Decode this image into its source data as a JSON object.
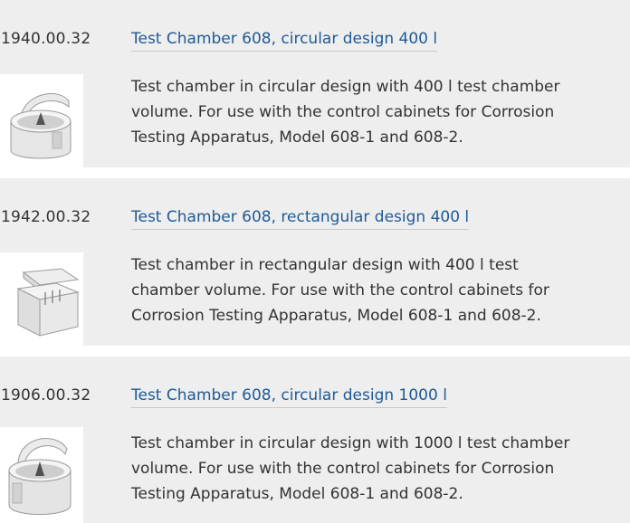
{
  "products": [
    {
      "code": "1940.00.32",
      "title": "Test Chamber 608, circular design 400 l",
      "description_lines": [
        "Test chamber in circular design with 400 l test chamber",
        "volume. For use with the control cabinets for Corrosion",
        "Testing Apparatus, Model 608-1 and 608-2."
      ],
      "image_icon": "circular-test-chamber-image"
    },
    {
      "code": "1942.00.32",
      "title": "Test Chamber 608, rectangular design 400 l",
      "description_lines": [
        "Test chamber in rectangular design with 400 l test",
        "chamber volume. For use with the control cabinets for",
        "Corrosion Testing Apparatus, Model 608-1 and 608-2."
      ],
      "image_icon": "rectangular-test-chamber-image"
    },
    {
      "code": "1906.00.32",
      "title": "Test Chamber 608, circular design 1000 l",
      "description_lines": [
        "Test chamber in circular design with 1000 l test chamber",
        "volume. For use with the control cabinets for Corrosion",
        "Testing Apparatus, Model 608-1 and 608-2."
      ],
      "image_icon": "circular-test-chamber-image"
    }
  ],
  "colors": {
    "row_background": "#eeeeee",
    "link": "#1f5a96",
    "text": "#333333"
  }
}
